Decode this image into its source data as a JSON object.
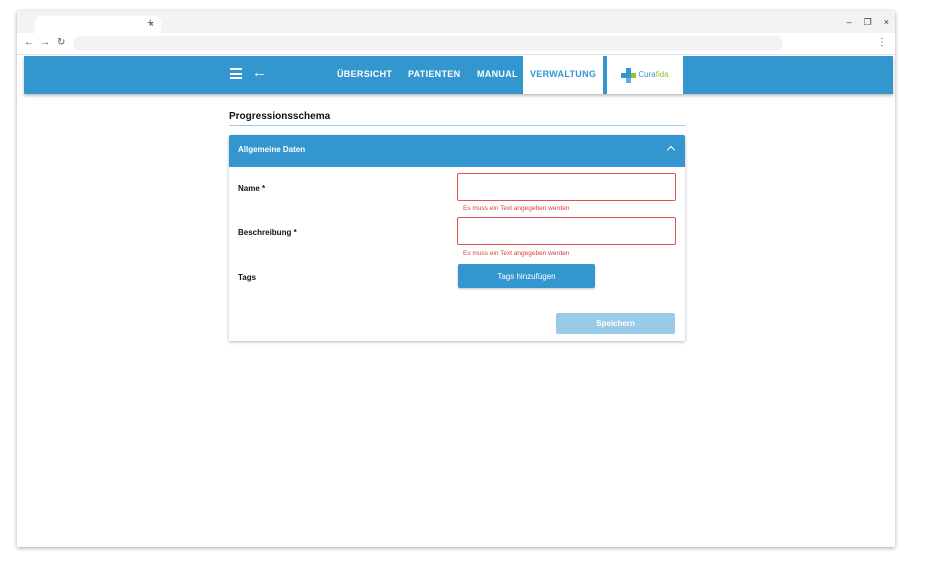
{
  "browser": {
    "tab_close": "×",
    "new_tab": "+",
    "window_controls": {
      "minimize": "–",
      "restore": "❐",
      "close": "×"
    },
    "back": "←",
    "forward": "→",
    "reload": "↻",
    "menu": "⋮"
  },
  "header": {
    "nav": [
      "ÜBERSICHT",
      "PATIENTEN",
      "MANUAL",
      "VERWALTUNG"
    ],
    "active_nav": "VERWALTUNG",
    "logo": {
      "part1": "Cura",
      "part2": "fida"
    },
    "accent_color": "#3396cf",
    "icons": [
      "hamburger-menu-icon",
      "arrow-back-icon"
    ]
  },
  "page": {
    "title": "Progressionsschema"
  },
  "form": {
    "section_title": "Allgemeine Daten",
    "fields": [
      {
        "label": "Name *",
        "value": "",
        "error": "Es muss ein Text angegeben werden"
      },
      {
        "label": "Beschreibung *",
        "value": "",
        "error": "Es muss ein Text angegeben werden"
      }
    ],
    "tags_label": "Tags",
    "tags_button": "Tags hinzufügen",
    "save_button": "Speichern",
    "error_color": "#e05353"
  }
}
